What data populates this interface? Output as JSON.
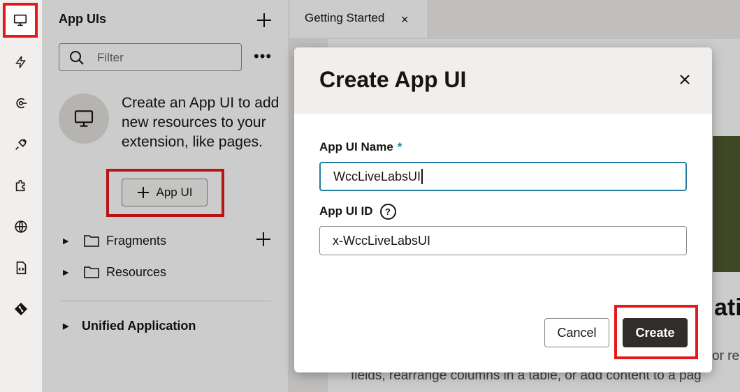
{
  "rail": {
    "items": [
      {
        "icon": "monitor-icon",
        "active": true
      },
      {
        "icon": "lightning-icon"
      },
      {
        "icon": "event-icon"
      },
      {
        "icon": "plug-icon"
      },
      {
        "icon": "puzzle-icon"
      },
      {
        "icon": "globe-icon"
      },
      {
        "icon": "code-file-icon"
      },
      {
        "icon": "git-icon"
      }
    ]
  },
  "panel": {
    "title": "App UIs",
    "filter_placeholder": "Filter",
    "more_label": "•••",
    "empty_message": "Create an App UI to add new resources to your extension, like pages.",
    "add_app_ui_label": "App UI",
    "tree": [
      {
        "label": "Fragments"
      },
      {
        "label": "Resources"
      }
    ],
    "section": "Unified Application"
  },
  "main": {
    "tab_label": "Getting Started",
    "tab_close": "×",
    "partial_heading": "atio",
    "partial_text1": "or re",
    "partial_text2": "fields, rearrange columns in a table, or add content to a pag"
  },
  "dialog": {
    "title": "Create App UI",
    "name_label": "App UI Name",
    "required_marker": "*",
    "name_value": "WccLiveLabsUI",
    "id_label": "App UI ID",
    "help_glyph": "?",
    "id_value": "x-WccLiveLabsUI",
    "cancel_label": "Cancel",
    "create_label": "Create"
  },
  "colors": {
    "highlight": "#e5191c",
    "focus": "#227e9e",
    "primary_button": "#312d2a"
  }
}
